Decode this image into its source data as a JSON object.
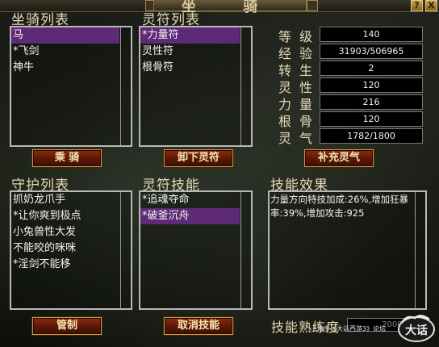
{
  "window": {
    "title": "坐 骑",
    "help": "?",
    "close": "X"
  },
  "mount_list": {
    "heading": "坐骑列表",
    "items": [
      "马",
      "*飞剑",
      "神牛"
    ],
    "selected_index": 0
  },
  "talisman_list": {
    "heading": "灵符列表",
    "items": [
      "*力量符",
      "灵性符",
      "根骨符"
    ],
    "selected_index": 0
  },
  "stats": [
    {
      "label": "等级",
      "value": "140"
    },
    {
      "label": "经验",
      "value": "31903/506965"
    },
    {
      "label": "转生",
      "value": "2"
    },
    {
      "label": "灵性",
      "value": "120"
    },
    {
      "label": "力量",
      "value": "216"
    },
    {
      "label": "根骨",
      "value": "120"
    },
    {
      "label": "灵气",
      "value": "1782/1800"
    }
  ],
  "buttons": {
    "ride": "乘 骑",
    "unload_talisman": "卸下灵符",
    "refill_spirit": "补充灵气",
    "control": "管制",
    "cancel_skill": "取消技能"
  },
  "guard_list": {
    "heading": "守护列表",
    "items": [
      "抓奶龙爪手",
      "*让你爽到极点",
      "小兔兽性大发",
      "不能咬的咪咪",
      "*淫剑不能移"
    ]
  },
  "talisman_skills": {
    "heading": "灵符技能",
    "items": [
      "*追魂夺命",
      "*破釜沉舟"
    ],
    "selected_index": 1
  },
  "skill_effect": {
    "heading": "技能效果",
    "text": "力量方向特技加成:26%,增加狂暴率:39%,增加攻击:925"
  },
  "proficiency": {
    "label": "技能熟练度",
    "value": "20000"
  },
  "watermark": "上海手《大话西游3》论坛",
  "logo_text": "大话"
}
